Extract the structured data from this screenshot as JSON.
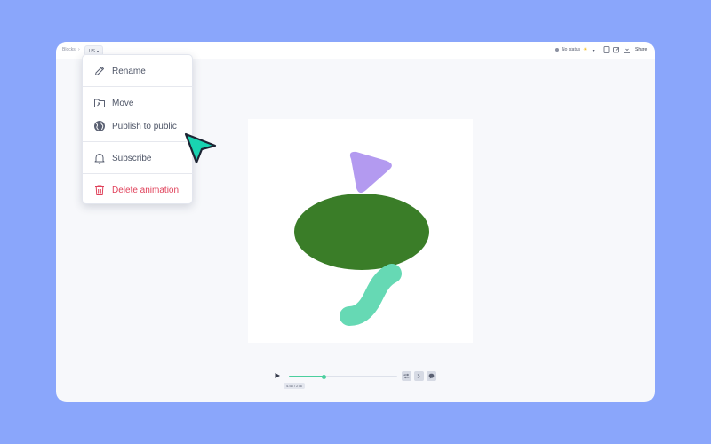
{
  "breadcrumb": {
    "root": "Blocks",
    "separator": "›",
    "current": "US",
    "chevron": "▾"
  },
  "toolbar": {
    "status_label": "No status",
    "status_chevron": "▾",
    "sun_icon": "☀",
    "icons": [
      "device-icon",
      "edit-icon",
      "download-icon"
    ],
    "share_label": "Share"
  },
  "context_menu": {
    "items": [
      {
        "label": "Rename",
        "icon": "pencil-icon"
      },
      {
        "label": "Move",
        "icon": "folder-move-icon"
      },
      {
        "label": "Publish to public",
        "icon": "globe-icon"
      },
      {
        "label": "Subscribe",
        "icon": "bell-icon"
      },
      {
        "label": "Delete animation",
        "icon": "trash-icon",
        "danger": true
      }
    ]
  },
  "player": {
    "time_label": "4.58 / 276",
    "progress": 0.32,
    "controls": [
      "loop-icon",
      "speed-icon",
      "comment-icon"
    ]
  },
  "colors": {
    "background": "#8aa6fb",
    "ellipse": "#3a7d28",
    "triangle": "#b39af0",
    "squiggle": "#66d9b4",
    "accent": "#4bcf9e",
    "cursor": "#19d3b1",
    "danger": "#e0415a"
  }
}
